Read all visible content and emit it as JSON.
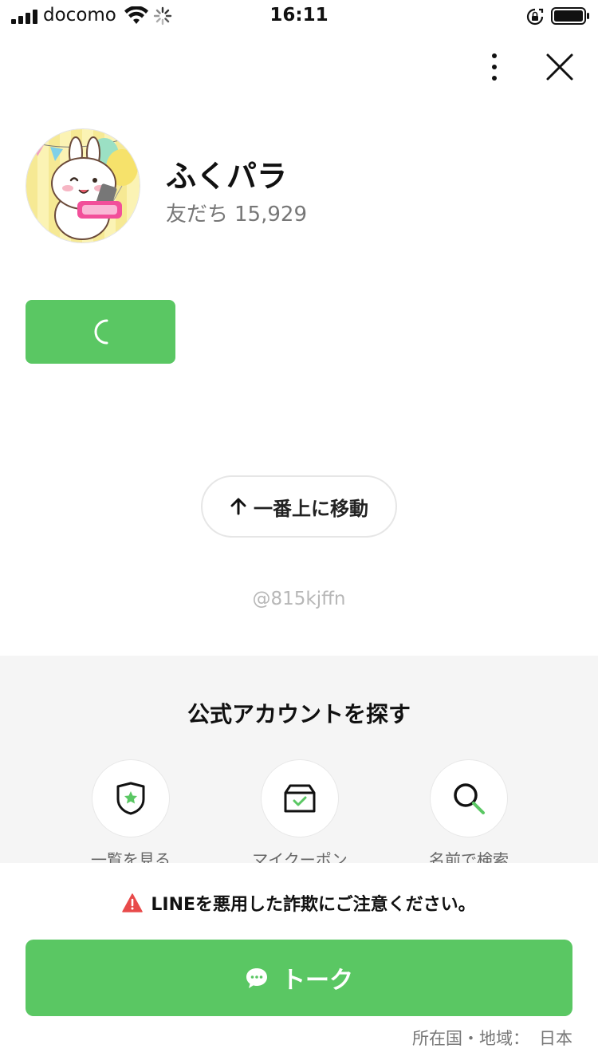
{
  "status_bar": {
    "carrier": "docomo",
    "time": "16:11"
  },
  "profile": {
    "name": "ふくパラ",
    "friends_label": "友だち",
    "friends_count": "15,929",
    "avatar_icon": "bunny-mascot-avatar"
  },
  "scroll_top": {
    "label": "一番上に移動"
  },
  "account_id": "@815kjffn",
  "find_section": {
    "title": "公式アカウントを探す",
    "items": [
      {
        "label": "一覧を見る",
        "icon": "shield-star-icon"
      },
      {
        "label": "マイクーポン",
        "icon": "coupon-box-icon"
      },
      {
        "label": "名前で検索",
        "icon": "search-icon"
      }
    ]
  },
  "warning_text": "LINEを悪用した詐欺にご注意ください。",
  "talk_button": {
    "label": "トーク"
  },
  "region": {
    "label": "所在国・地域：",
    "value": "日本"
  },
  "colors": {
    "accent_green": "#5ac763",
    "warning_red": "#e84a4a",
    "section_bg": "#f5f5f5"
  }
}
